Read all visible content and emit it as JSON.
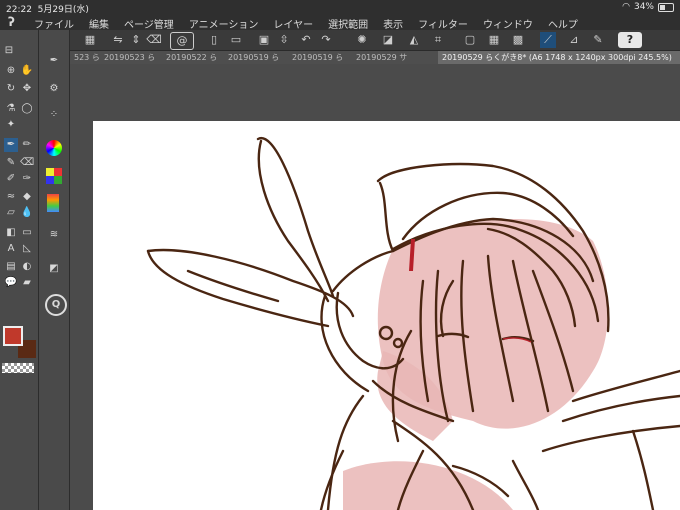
{
  "status": {
    "time": "22:22",
    "date": "5月29日(水)",
    "battery": "34%"
  },
  "menu": [
    "ファイル",
    "編集",
    "ページ管理",
    "アニメーション",
    "レイヤー",
    "選択範囲",
    "表示",
    "フィルター",
    "ウィンドウ",
    "ヘルプ"
  ],
  "toolbar": {
    "help_label": "?"
  },
  "tabs": [
    "523 ら",
    "20190523 ら",
    "20190522 ら",
    "20190519 ら",
    "20190519 ら",
    "20190529 サ",
    "20190529 らくがき8* (A6 1748 x 1240px 300dpi 245.5%)"
  ],
  "tools": {
    "text_tool_glyph": "A",
    "zoom_glyph": "Q"
  },
  "colors": {
    "main": "#c0392b",
    "sub": "#5a2a14",
    "stroke": "#4a2612",
    "blush": "#e9b6b5",
    "accent": "#b7202a"
  }
}
